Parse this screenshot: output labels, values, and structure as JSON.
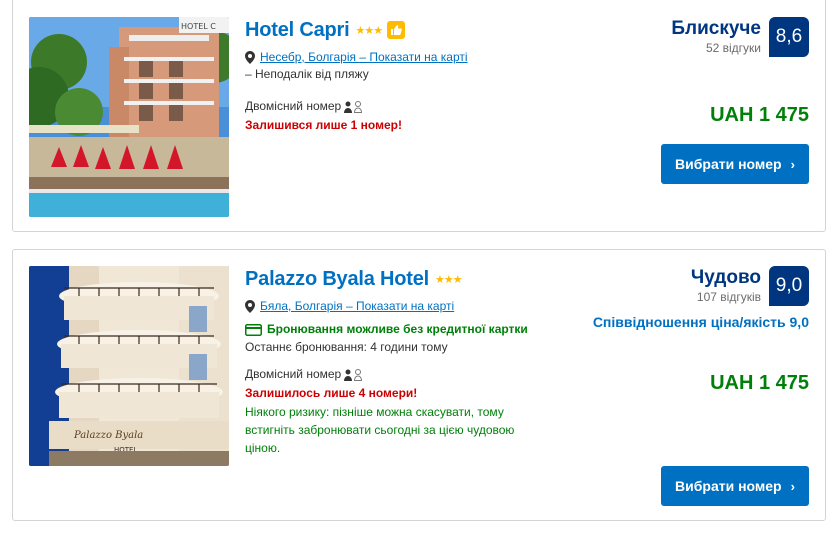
{
  "hotels": [
    {
      "name": "Hotel Capri",
      "stars": "★★★",
      "location_link": "Несебр, Болгарія – Показати на карті",
      "beach_note": "– Неподалік від пляжу",
      "room": "Двомісний номер",
      "rooms_left": "Залишився лише 1 номер!",
      "review_word": "Блискуче",
      "review_count": "52 відгуки",
      "score": "8,6",
      "price": "UAH 1 475",
      "button": "Вибрати номер",
      "photo_sign": "HOTEL C"
    },
    {
      "name": "Palazzo Byala Hotel",
      "stars": "★★★",
      "location_link": "Бяла, Болгарія – Показати на карті",
      "no_credit_card": "Бронювання можливе без кредитної картки",
      "last_booked": "Останнє бронювання: 4 години тому",
      "room": "Двомісний номер",
      "rooms_left": "Залишилось лише 4 номери!",
      "risk_free": "Ніякого ризику: пізніше можна скасувати, тому встигніть забронювати сьогодні за цією чудовою ціною.",
      "review_word": "Чудово",
      "review_count": "107 відгуків",
      "score": "9,0",
      "value_for_money": "Співвідношення ціна/якість 9,0",
      "price": "UAH 1 475",
      "button": "Вибрати номер",
      "photo_sign": "Palazzo Byala",
      "photo_sign2": "HOTEL"
    }
  ],
  "colors": {
    "link_blue": "#0071c2",
    "dark_blue": "#003580",
    "price_green": "#008009",
    "urgent_red": "#cc0000",
    "star_yellow": "#febb02"
  }
}
